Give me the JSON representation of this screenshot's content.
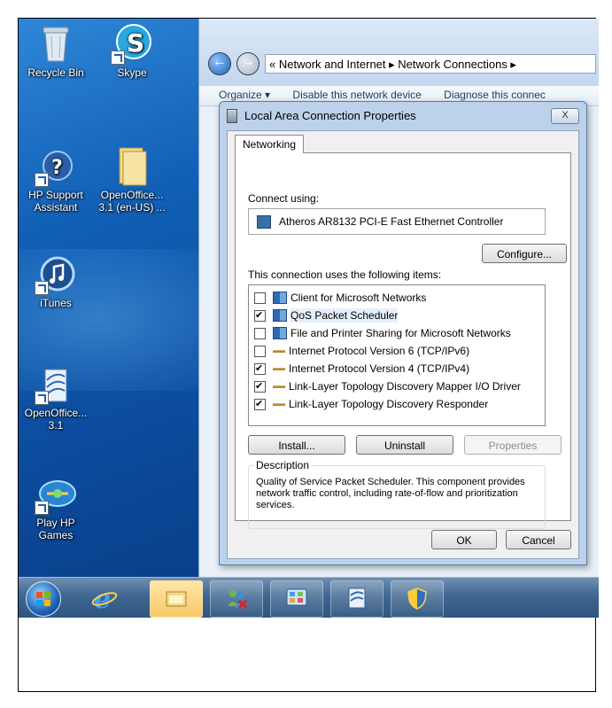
{
  "desktop": {
    "icons": [
      {
        "label": "Recycle Bin",
        "icon": "recycle-bin-icon"
      },
      {
        "label": "Skype",
        "icon": "skype-icon"
      },
      {
        "label": "HP Support Assistant",
        "icon": "hp-support-icon"
      },
      {
        "label": "OpenOffice... 3.1 (en-US) ...",
        "icon": "folder-icon"
      },
      {
        "label": "iTunes",
        "icon": "itunes-icon"
      },
      {
        "label": "OpenOffice... 3.1",
        "icon": "openoffice-icon"
      },
      {
        "label": "Play HP Games",
        "icon": "hp-games-icon"
      }
    ]
  },
  "explorer": {
    "breadcrumb": "« Network and Internet ▸ Network Connections ▸",
    "toolbar": [
      "Organize ▾",
      "Disable this network device",
      "Diagnose this connec"
    ]
  },
  "dialog": {
    "title": "Local Area Connection Properties",
    "close_label": "X",
    "tab_label": "Networking",
    "connect_using_label": "Connect using:",
    "adapter_name": "Atheros AR8132 PCI-E Fast Ethernet Controller",
    "configure_label": "Configure...",
    "items_label": "This connection uses the following items:",
    "items": [
      {
        "label": "Client for Microsoft Networks",
        "checked": false,
        "icon": "network-client-icon"
      },
      {
        "label": "QoS Packet Scheduler",
        "checked": true,
        "icon": "network-service-icon"
      },
      {
        "label": "File and Printer Sharing for Microsoft Networks",
        "checked": false,
        "icon": "network-service-icon"
      },
      {
        "label": "Internet Protocol Version 6 (TCP/IPv6)",
        "checked": false,
        "icon": "protocol-icon"
      },
      {
        "label": "Internet Protocol Version 4 (TCP/IPv4)",
        "checked": true,
        "icon": "protocol-icon"
      },
      {
        "label": "Link-Layer Topology Discovery Mapper I/O Driver",
        "checked": true,
        "icon": "protocol-icon"
      },
      {
        "label": "Link-Layer Topology Discovery Responder",
        "checked": true,
        "icon": "protocol-icon"
      }
    ],
    "selected_item": "QoS Packet Scheduler",
    "install_label": "Install...",
    "uninstall_label": "Uninstall",
    "properties_label": "Properties",
    "description_legend": "Description",
    "description_text": "Quality of Service Packet Scheduler.  This component provides network traffic control, including rate-of-flow and prioritization services.",
    "ok_label": "OK",
    "cancel_label": "Cancel"
  },
  "taskbar": {
    "items": [
      "start-orb-icon",
      "internet-explorer-icon",
      "windows-explorer-icon",
      "user-accounts-icon",
      "control-panel-icon",
      "openoffice-icon",
      "security-shield-icon"
    ]
  }
}
